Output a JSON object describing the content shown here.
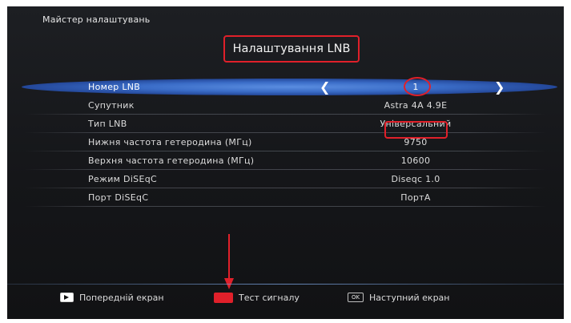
{
  "wizard": {
    "title": "Майстер налаштувань"
  },
  "page": {
    "title": "Налаштування LNB"
  },
  "settings": [
    {
      "label": "Номер LNB",
      "value": "1"
    },
    {
      "label": "Супутник",
      "value": "Astra 4A 4.9E"
    },
    {
      "label": "Тип LNB",
      "value": "Універсальний"
    },
    {
      "label": "Нижня частота гетеродина (МГц)",
      "value": "9750"
    },
    {
      "label": "Верхня частота гетеродина (МГц)",
      "value": "10600"
    },
    {
      "label": "Режим DiSEqC",
      "value": "Diseqc 1.0"
    },
    {
      "label": "Порт DiSEqC",
      "value": "ПортА"
    }
  ],
  "selector": {
    "left_arrow": "❮",
    "right_arrow": "❯"
  },
  "footer": {
    "prev_label": "Попередній екран",
    "test_label": "Тест сигналу",
    "ok_key": "OK",
    "next_label": "Наступний екран"
  },
  "colors": {
    "annotation_red": "#e0202a",
    "selection_blue": "#3a6cc7",
    "background": "#151619"
  }
}
